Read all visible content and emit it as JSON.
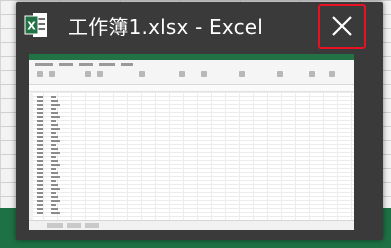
{
  "thumbnail": {
    "title": "工作簿1.xlsx - Excel",
    "app_icon": "excel-icon",
    "close_icon": "close-icon"
  },
  "colors": {
    "excel_green": "#217346",
    "close_highlight": "#e81123",
    "card_background": "#3a3a3a"
  }
}
